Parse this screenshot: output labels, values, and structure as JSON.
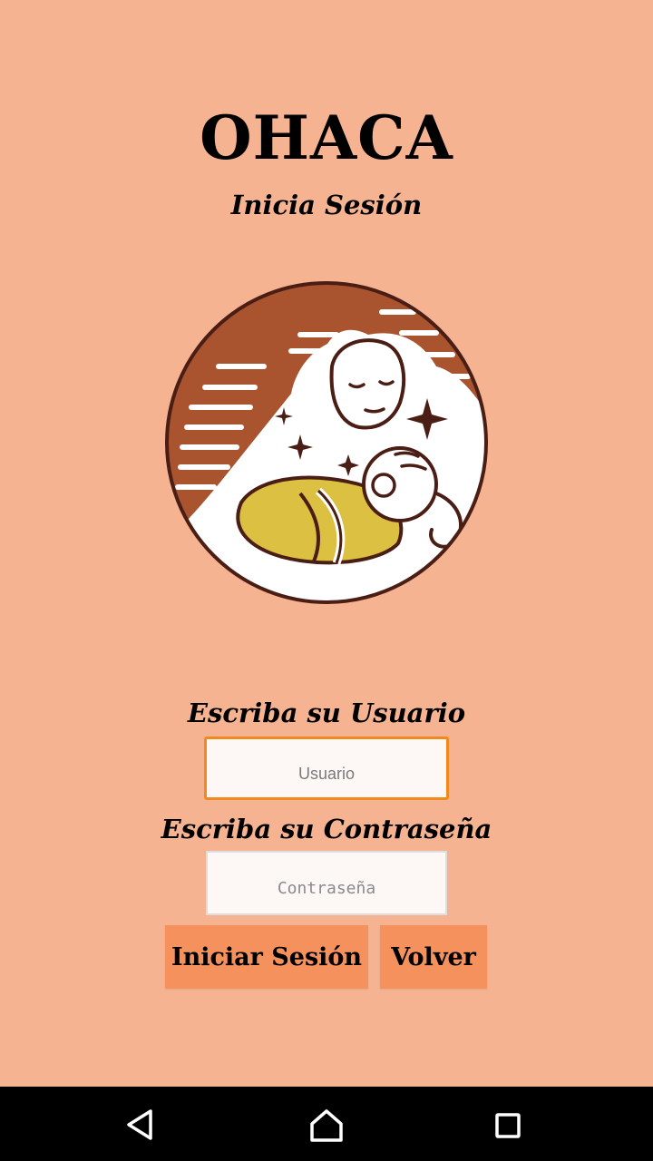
{
  "app": {
    "title": "OHACA",
    "subtitle": "Inicia Sesión"
  },
  "logo": {
    "icon": "mother-holding-baby-logo",
    "colors": {
      "rust": "#a9532f",
      "outline": "#4a1e14",
      "blanket": "#dcc042",
      "white": "#ffffff"
    }
  },
  "form": {
    "username_label": "Escriba su Usuario",
    "username_placeholder": "Usuario",
    "password_label": "Escriba su Contraseña",
    "password_placeholder": "Contraseña"
  },
  "buttons": {
    "login": "Iniciar Sesión",
    "back": "Volver"
  },
  "navigation_bar": {
    "items": [
      "back-icon",
      "home-icon",
      "recent-apps-icon"
    ]
  },
  "colors": {
    "background": "#f5b391",
    "button": "#f4915d",
    "focus_border": "#f08a1e"
  }
}
